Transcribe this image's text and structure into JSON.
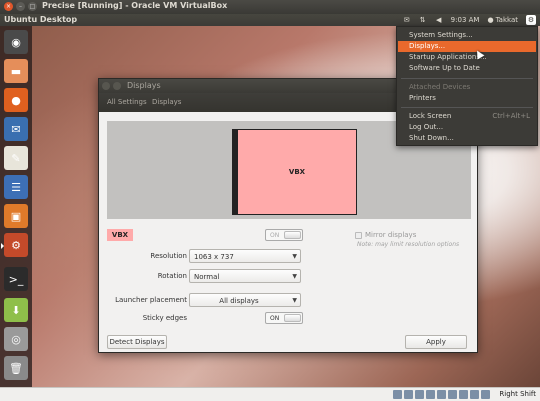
{
  "vbox": {
    "title": "Precise [Running] - Oracle VM VirtualBox",
    "status_icons": [
      "hdd-icon",
      "cd-icon",
      "usb-icon",
      "network-icon",
      "shared-folder-icon",
      "display-icon",
      "capture-icon",
      "mouse-icon",
      "keyboard-icon"
    ],
    "host_key": "Right Shift"
  },
  "panel": {
    "desktop_label": "Ubuntu Desktop",
    "tray": {
      "time": "9:03 AM",
      "user": "Takkat"
    }
  },
  "launcher": {
    "items": [
      {
        "icon": "ubuntu-dash-icon",
        "color": "#4a4a4a"
      },
      {
        "icon": "home-folder-icon",
        "color": "#e58e5a"
      },
      {
        "icon": "firefox-icon",
        "color": "#e0601f"
      },
      {
        "icon": "thunderbird-icon",
        "color": "#3a6fb0"
      },
      {
        "icon": "text-editor-icon",
        "color": "#e8e5da"
      },
      {
        "icon": "libreoffice-writer-icon",
        "color": "#3d6fb6"
      },
      {
        "icon": "ubuntu-software-center-icon",
        "color": "#e07a2a"
      },
      {
        "icon": "system-settings-icon",
        "color": "#c44a2a"
      },
      {
        "icon": "terminal-icon",
        "color": "#2b2b2b"
      },
      {
        "icon": "update-manager-icon",
        "color": "#8fbf4a"
      },
      {
        "icon": "disk-icon",
        "color": "#9a9a9a"
      },
      {
        "icon": "trash-icon",
        "color": "#8a8a8a"
      }
    ]
  },
  "window": {
    "title": "Displays",
    "breadcrumb": [
      "All Settings",
      "Displays"
    ],
    "monitor_label": "VBX",
    "display_tag": "VBX",
    "display_toggle": "ON",
    "mirror_label": "Mirror displays",
    "note": "Note: may limit resolution options",
    "resolution": {
      "label": "Resolution",
      "value": "1063 x 737"
    },
    "rotation": {
      "label": "Rotation",
      "value": "Normal"
    },
    "launcher_placement": {
      "label": "Launcher placement",
      "value": "All displays"
    },
    "sticky_edges": {
      "label": "Sticky edges",
      "value": "ON"
    },
    "detect_button": "Detect Displays",
    "apply_button": "Apply"
  },
  "menu": {
    "items": [
      {
        "label": "System Settings...",
        "state": "normal"
      },
      {
        "label": "Displays...",
        "state": "highlighted"
      },
      {
        "label": "Startup Applications...",
        "state": "normal"
      },
      {
        "label": "Software Up to Date",
        "state": "normal"
      },
      {
        "label": "Attached Devices",
        "state": "disabled"
      },
      {
        "label": "Printers",
        "state": "normal"
      },
      {
        "label": "Lock Screen",
        "state": "normal",
        "accel": "Ctrl+Alt+L"
      },
      {
        "label": "Log Out...",
        "state": "normal"
      },
      {
        "label": "Shut Down...",
        "state": "normal"
      }
    ]
  },
  "colors": {
    "accent": "#e9692c",
    "monitor_fill": "#ffaaaa",
    "panel": "#3c3b37"
  }
}
